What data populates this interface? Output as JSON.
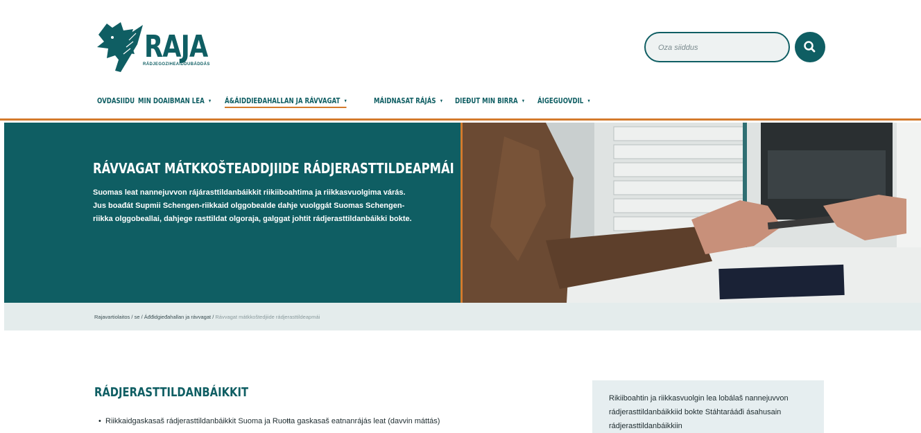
{
  "header": {
    "logo_text": "RAJA",
    "logo_subtitle": "RÁDJEGOZIHEAIDDUBÁDDÁS",
    "search": {
      "placeholder": "Oza siiddus",
      "icon": "search-icon"
    }
  },
  "nav": {
    "items": [
      {
        "label": "OVDASIIDU",
        "dropdown": false
      },
      {
        "label": "MIN DOAIBMAN LEA",
        "dropdown": true
      },
      {
        "label": "Á&ÁIDDIEĐAHALLAN JA RÁVVAGAT",
        "dropdown": true,
        "active": true
      },
      {
        "label": "MÁIDNASAT RÁJÁS",
        "dropdown": true
      },
      {
        "label": "DIEĐUT MIN BIRRA",
        "dropdown": true
      },
      {
        "label": "ÁIGEGUOVDIL",
        "dropdown": true
      }
    ]
  },
  "hero": {
    "title": "RÁVVAGAT MÁTKKOŠTEADDJIIDE RÁDJERASTTILDEAPMÁI",
    "text": "Suomas leat nannejuvvon rájárasttildanbáikkit riikiiboahtima ja riikkasvuolgima várás. Jus boađát Supmii Schengen-riikkaid olggobealde dahje vuolggát Suomas Schengen-riikka olggobeallai, dahjege rasttildat olgoraja, galggat johtit rádjerasttildanbáikki bokte.",
    "image_alt": "passport handed over at border control counter"
  },
  "breadcrumb": {
    "items": [
      "Rajavartiolaitos",
      "se",
      "Áđđidgieđahallan ja rávvagat",
      "Rávvagat mátkkoštedjiide rádjerasttildeapmái"
    ],
    "separator": "/"
  },
  "main": {
    "section_title": "RÁDJERASTTILDANBÁIKKIT",
    "bullet_1": "Riikkaidgaskasaš rádjerasttildanbáikkit Suoma ja Ruoŧŧa gaskasaš eatnanrájás leat (davvin máttás)"
  },
  "sidebox": {
    "text": "Rikiiboahtin ja riikkasvuolgin lea lobálaš nannejuvvon rádjerasttildanbáikkiid bokte Stáhtarááđi ásahusain rádjerasttildanbáikkiin"
  },
  "colors": {
    "brand": "#0f5e63",
    "accent": "#d47a2c",
    "breadcrumb_bg": "#e4ecec"
  }
}
